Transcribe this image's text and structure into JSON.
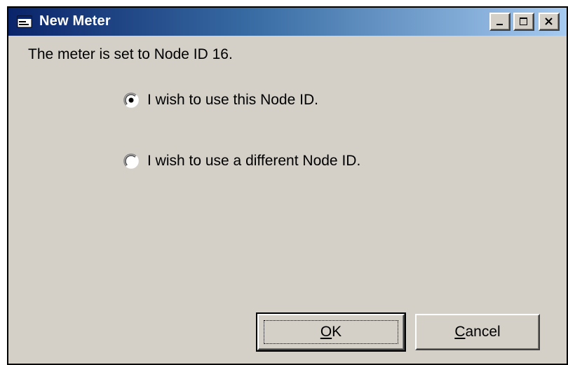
{
  "window": {
    "title": "New Meter",
    "icon": "window-app-icon",
    "controls": {
      "minimize": "minimize-icon",
      "maximize": "maximize-icon",
      "close": "close-icon"
    }
  },
  "message": "The meter is set to Node ID 16.",
  "options": [
    {
      "label": "I wish to use this Node ID.",
      "selected": true
    },
    {
      "label": "I wish to use a different Node ID.",
      "selected": false
    }
  ],
  "buttons": {
    "ok": {
      "accel": "O",
      "rest": "K"
    },
    "cancel": {
      "accel": "C",
      "rest": "ancel"
    }
  },
  "colors": {
    "title_gradient_start": "#0a246a",
    "title_gradient_end": "#a6caf0",
    "face": "#d4d0c8"
  }
}
